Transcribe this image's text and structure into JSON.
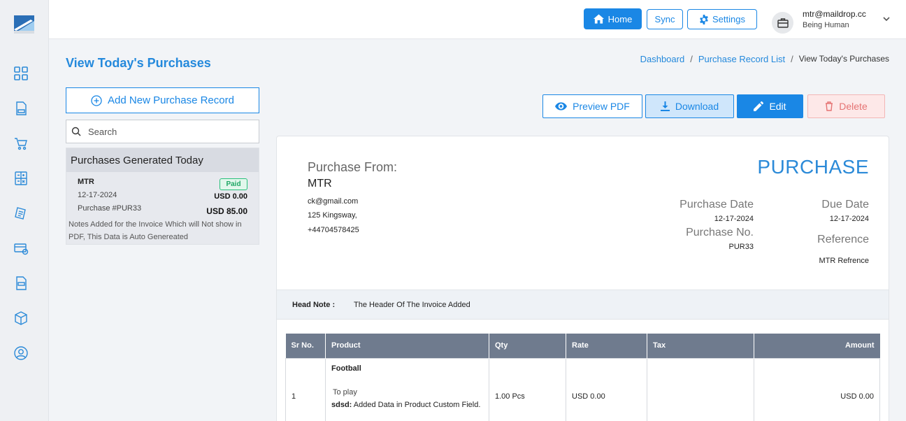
{
  "topbar": {
    "home_label": "Home",
    "sync_label": "Sync",
    "settings_label": "Settings",
    "user_email": "mtr@maildrop.cc",
    "user_sub": "Being Human"
  },
  "sidebar": {
    "items": [
      {
        "icon": "dashboard-grid-icon"
      },
      {
        "icon": "invoice-icon"
      },
      {
        "icon": "cart-icon"
      },
      {
        "icon": "calculator-icon"
      },
      {
        "icon": "receipt-icon"
      },
      {
        "icon": "payment-card-icon"
      },
      {
        "icon": "document-icon"
      },
      {
        "icon": "box-icon"
      },
      {
        "icon": "user-icon"
      }
    ]
  },
  "page": {
    "title": "View Today's Purchases",
    "breadcrumb": [
      "Dashboard",
      "Purchase Record List",
      "View Today's Purchases"
    ],
    "separator": "/"
  },
  "left": {
    "add_label": "Add New Purchase Record",
    "search_placeholder": "Search",
    "list_header": "Purchases Generated Today",
    "items": [
      {
        "name": "MTR",
        "date": "12-17-2024",
        "number": "Purchase #PUR33",
        "status": "Paid",
        "amount_paid": "USD 0.00",
        "total": "USD 85.00",
        "note": "Notes Added for the Invoice Which will Not show in PDF, This Data is Auto Genereated"
      }
    ]
  },
  "actions": {
    "preview": "Preview PDF",
    "download": "Download",
    "edit": "Edit",
    "delete": "Delete"
  },
  "invoice": {
    "from_label": "Purchase From:",
    "from_name": "MTR",
    "from_email": "ck@gmail.com",
    "from_address": "125 Kingsway,",
    "from_phone": "+44704578425",
    "title": "PURCHASE",
    "purchase_date_label": "Purchase Date",
    "purchase_date": "12-17-2024",
    "due_date_label": "Due Date",
    "due_date": "12-17-2024",
    "purchase_no_label": "Purchase No.",
    "purchase_no": "PUR33",
    "reference_label": "Reference",
    "reference": "MTR Refrence",
    "head_note_label": "Head Note :",
    "head_note": "The Header Of The Invoice Added",
    "columns": [
      "Sr No.",
      "Product",
      "Qty",
      "Rate",
      "Tax",
      "Amount"
    ],
    "rows": [
      {
        "sr": "1",
        "product": "Football",
        "description": "To play",
        "custom_label": "sdsd:",
        "custom_value": "Added Data in Product Custom Field.",
        "qty": "1.00 Pcs",
        "rate": "USD 0.00",
        "tax": "",
        "amount": "USD 0.00"
      }
    ]
  },
  "colors": {
    "accent": "#1a87e5",
    "title_blue": "#2489dc",
    "paid_green": "#1fa765",
    "delete_red": "#e57373",
    "table_header": "#6f7b8e"
  }
}
